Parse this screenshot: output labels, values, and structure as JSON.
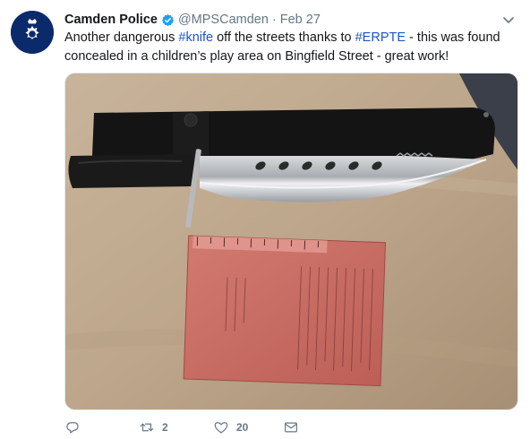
{
  "tweet": {
    "author_name": "Camden Police",
    "handle": "@MPSCamden",
    "separator": "·",
    "timestamp": "Feb 27",
    "text_parts": [
      {
        "text": "Another dangerous ",
        "hashtag": false
      },
      {
        "text": "#knife",
        "hashtag": true
      },
      {
        "text": " off the streets thanks to ",
        "hashtag": false
      },
      {
        "text": "#ERPTE",
        "hashtag": true
      },
      {
        "text": " - this was found concealed in a children’s play area on Bingfield Street - great work!",
        "hashtag": false
      }
    ],
    "verified": true
  },
  "actions": {
    "reply_count": "",
    "retweet_count": "2",
    "like_count": "20"
  },
  "icons": {
    "avatar": "met-police-crest-icon",
    "verified": "verified-badge-icon",
    "caret": "chevron-down-icon",
    "reply": "reply-icon",
    "retweet": "retweet-icon",
    "like": "heart-icon",
    "dm": "envelope-icon"
  },
  "colors": {
    "hashtag": "#1b55c4",
    "verified": "#1da1f2",
    "muted": "#657786",
    "avatar_bg": "#0b2a6b"
  }
}
